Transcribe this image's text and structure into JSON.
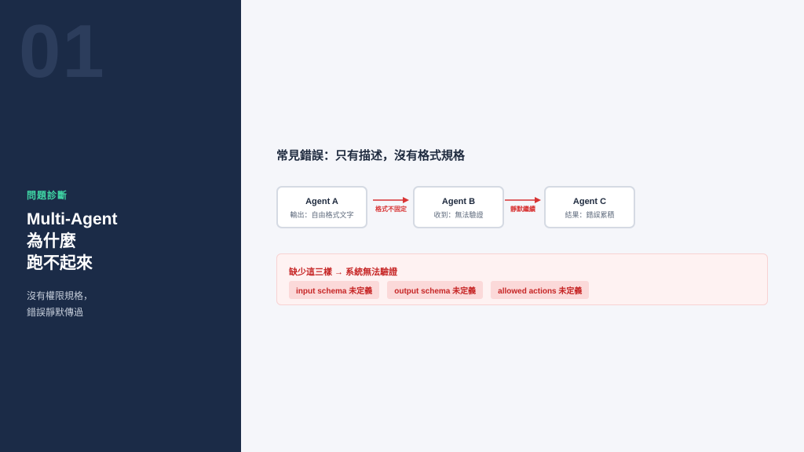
{
  "left": {
    "big_number": "01",
    "eyebrow": "問題診斷",
    "title_lines": [
      "Multi-Agent",
      "為什麼",
      "跑不起來"
    ],
    "subtitle_lines": [
      "沒有權限規格，",
      "錯誤靜默傳過"
    ]
  },
  "main": {
    "section_title": "常見錯誤：只有描述，沒有格式規格",
    "agents": [
      {
        "name": "Agent A",
        "desc": "輸出：自由格式文字"
      },
      {
        "name": "Agent B",
        "desc": "收到：無法驗證"
      },
      {
        "name": "Agent C",
        "desc": "結果：錯誤累積"
      }
    ],
    "arrows": [
      {
        "label": "格式不固定"
      },
      {
        "label": "靜默繼續"
      }
    ],
    "alert": {
      "title": "缺少這三樣 → 系統無法驗證",
      "tags": [
        "input schema 未定義",
        "output schema 未定義",
        "allowed actions 未定義"
      ]
    }
  },
  "colors": {
    "left_bg": "#1b2b47",
    "accent_green": "#3fd3a3",
    "error_red": "#d83434"
  }
}
